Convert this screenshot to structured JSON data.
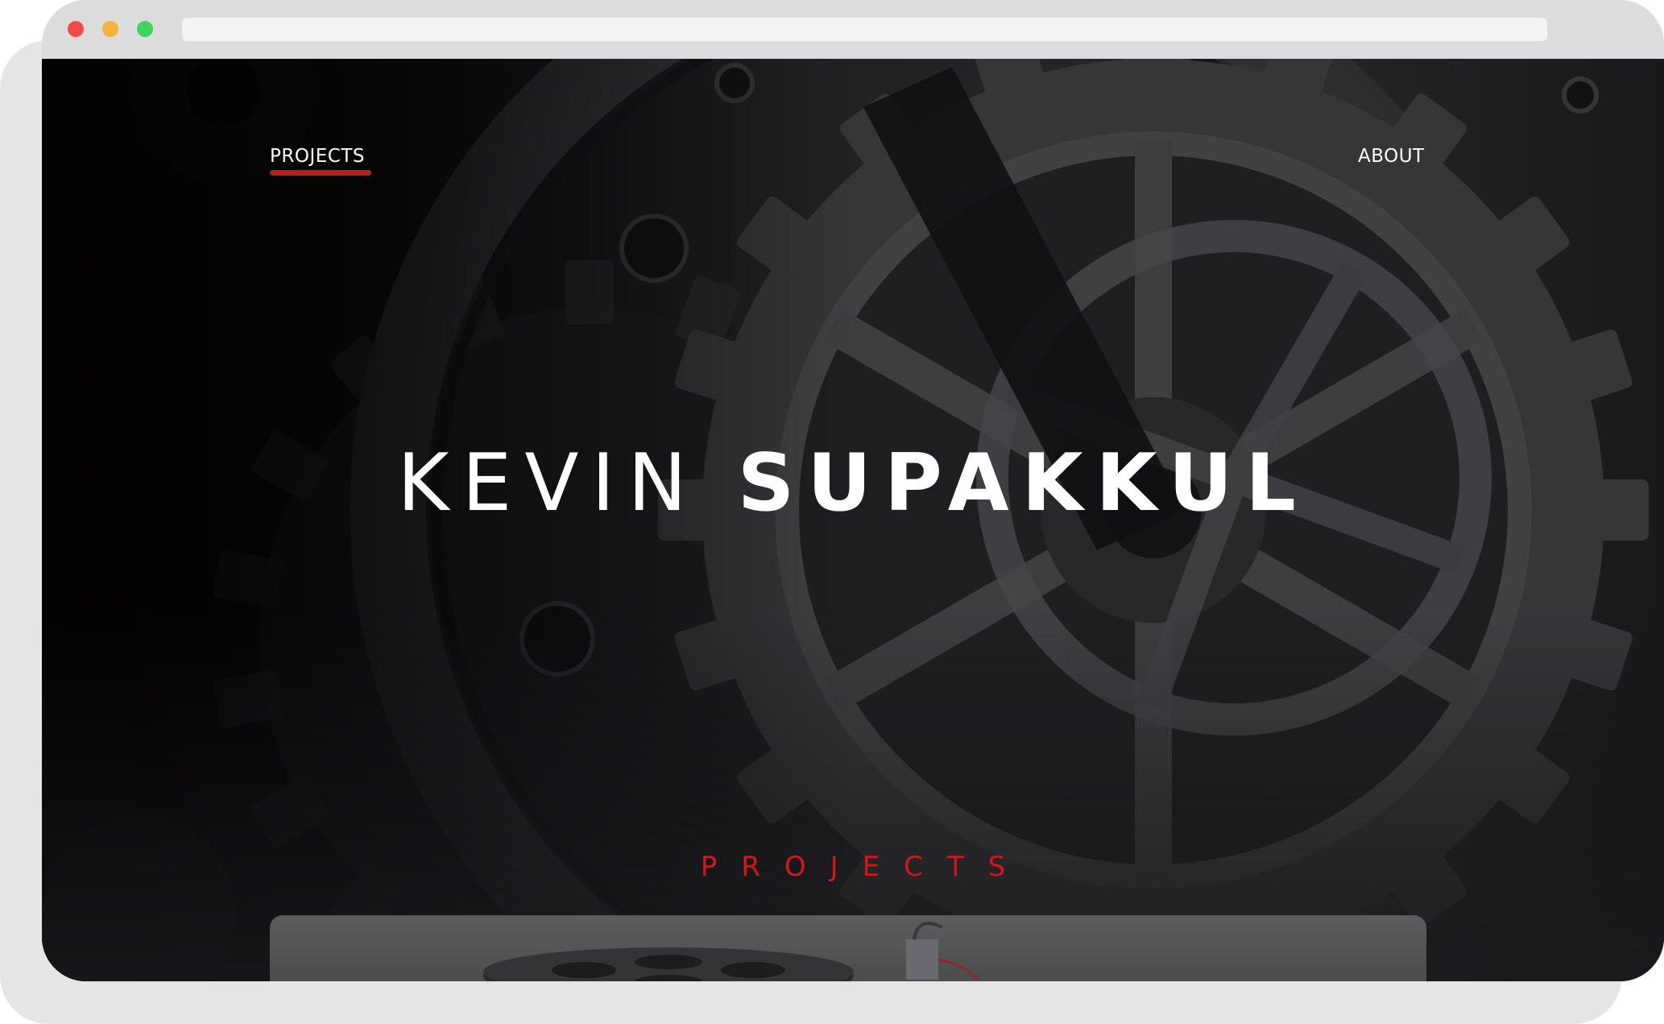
{
  "window": {
    "controls": [
      "close-dot",
      "minimize-dot",
      "maximize-dot"
    ],
    "colors": {
      "close": "#f0494b",
      "minimize": "#f7b23c",
      "maximize": "#3ed45f"
    }
  },
  "nav": {
    "projects_label": "PROJECTS",
    "about_label": "ABOUT",
    "active_underline_color": "#b51f23"
  },
  "hero": {
    "first_name": "KEVIN",
    "last_name": "SUPAKKUL",
    "background": "gear-mechanism-photo"
  },
  "projects_section": {
    "title": "PROJECTS",
    "title_color": "#d3181b"
  },
  "project_card": {
    "image": "gear-plate-on-concrete-photo"
  }
}
